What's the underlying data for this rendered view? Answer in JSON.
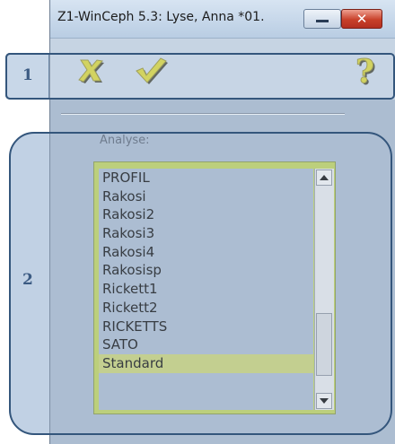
{
  "window": {
    "title": "Z1-WinCeph 5.3: Lyse, Anna *01."
  },
  "titlebar_buttons": {
    "minimize_icon": "minimize-icon",
    "close_label": "✕"
  },
  "toolbar": {
    "cancel_icon": "cross-icon",
    "ok_icon": "checkmark-icon",
    "help_icon": "question-mark-icon"
  },
  "analyse": {
    "label": "Analyse:",
    "items": [
      "PROFIL",
      "Rakosi",
      "Rakosi2",
      "Rakosi3",
      "Rakosi4",
      "Rakosisp",
      "Rickett1",
      "Rickett2",
      "RICKETTS",
      "SATO",
      "Standard"
    ],
    "selected": "Standard"
  },
  "callouts": {
    "one": "1",
    "two": "2"
  },
  "colors": {
    "list_border": "#c2d45e",
    "selection": "#cbd478",
    "window_bg": "#acbdd1",
    "callout_border": "#34567c"
  }
}
